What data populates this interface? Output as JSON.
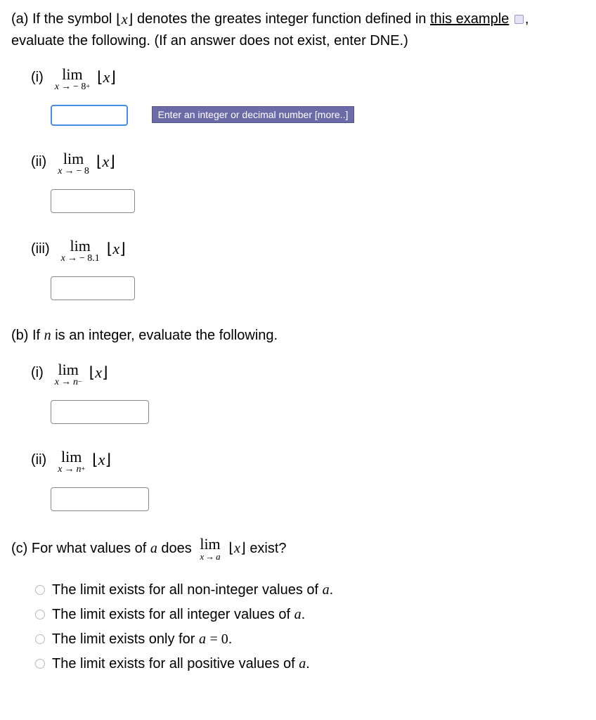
{
  "partA": {
    "intro_before": "(a) If the symbol ",
    "intro_mid": " denotes the greates integer function defined in ",
    "link_text": "this example",
    "intro_after": ", evaluate the following. (If an answer does not exist, enter DNE.)",
    "items": [
      {
        "roman": "(i)",
        "approach": "− 8",
        "sup": "+"
      },
      {
        "roman": "(ii)",
        "approach": "− 8",
        "sup": ""
      },
      {
        "roman": "(iii)",
        "approach": "− 8.1",
        "sup": ""
      }
    ],
    "tooltip": "Enter an integer or decimal number [more..]"
  },
  "partB": {
    "intro_before": "(b) If ",
    "intro_var": "n",
    "intro_after": " is an integer, evaluate the following.",
    "items": [
      {
        "roman": "(i)",
        "approach": "n",
        "sup": "−"
      },
      {
        "roman": "(ii)",
        "approach": "n",
        "sup": "+"
      }
    ]
  },
  "partC": {
    "intro_before": "(c) For what values of ",
    "intro_var": "a",
    "intro_mid": " does ",
    "lim_approach": "a",
    "intro_after": " exist?",
    "options": [
      "The limit exists for all non-integer values of a.",
      "The limit exists for all integer values of a.",
      "The limit exists only for a = 0.",
      "The limit exists for all positive values of a."
    ]
  },
  "sym": {
    "x": "x",
    "lim": "lim",
    "arrow": "→",
    "lfloor": "⌊",
    "rfloor": "⌋"
  }
}
